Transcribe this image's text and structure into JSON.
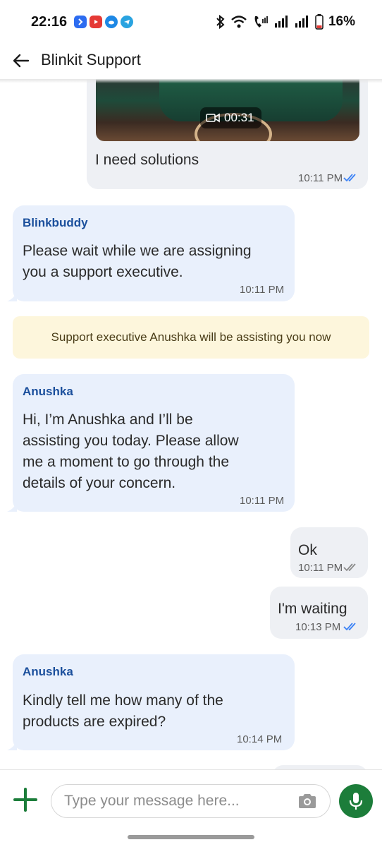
{
  "status_bar": {
    "time": "22:16",
    "battery": "16%",
    "icons": [
      "bluetooth-icon",
      "wifi-icon",
      "wifi-calling-icon",
      "signal-icon",
      "signal-icon",
      "battery-icon"
    ],
    "app_icons": [
      "blue-app-icon",
      "youtube-icon",
      "cloud-icon",
      "telegram-icon"
    ]
  },
  "header": {
    "title": "Blinkit Support"
  },
  "messages": [
    {
      "direction": "out",
      "video_duration": "00:31",
      "text": "I need solutions",
      "time": "10:11 PM",
      "status": "read"
    },
    {
      "direction": "in",
      "sender": "Blinkbuddy",
      "lines": [
        "Please wait while we are assigning",
        "you a support executive."
      ],
      "time": "10:11 PM"
    },
    {
      "direction": "system",
      "text": "Support executive Anushka will be assisting you now"
    },
    {
      "direction": "in",
      "sender": "Anushka",
      "lines": [
        "Hi, I’m Anushka and I’ll be",
        "assisting you today. Please allow",
        "me a moment to go through the",
        "details of your concern."
      ],
      "time": "10:11 PM"
    },
    {
      "direction": "out",
      "text": "Ok",
      "time": "10:11 PM",
      "status": "delivered"
    },
    {
      "direction": "out",
      "text": "I'm waiting",
      "time": "10:13 PM",
      "status": "read"
    },
    {
      "direction": "in",
      "sender": "Anushka",
      "lines": [
        "Kindly tell me how many of the",
        "products are expired?"
      ],
      "time": "10:14 PM"
    }
  ],
  "composer": {
    "placeholder": "Type your message here..."
  },
  "colors": {
    "accent_green": "#1c7d3a",
    "sender_blue": "#1b4f9c",
    "incoming_bubble": "#e9f0fc",
    "outgoing_bubble": "#eef0f4",
    "read_tick": "#3b82f6",
    "system_note": "#fdf6dc"
  }
}
